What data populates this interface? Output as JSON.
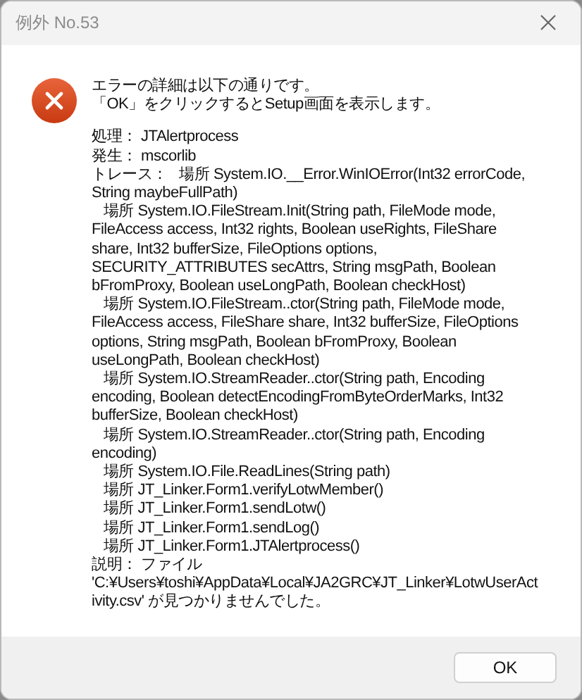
{
  "window": {
    "title": "例外 No.53"
  },
  "message": [
    "エラーの詳細は以下の通りです。",
    "「OK」をクリックするとSetup画面を表示します。"
  ],
  "details": [
    "処理： JTAlertprocess",
    "発生： mscorlib",
    "トレース：   場所 System.IO.__Error.WinIOError(Int32 errorCode,",
    "String maybeFullPath)",
    "   場所 System.IO.FileStream.Init(String path, FileMode mode,",
    "FileAccess access, Int32 rights, Boolean useRights, FileShare",
    "share, Int32 bufferSize, FileOptions options,",
    "SECURITY_ATTRIBUTES secAttrs, String msgPath, Boolean",
    "bFromProxy, Boolean useLongPath, Boolean checkHost)",
    "   場所 System.IO.FileStream..ctor(String path, FileMode mode,",
    "FileAccess access, FileShare share, Int32 bufferSize, FileOptions",
    "options, String msgPath, Boolean bFromProxy, Boolean",
    "useLongPath, Boolean checkHost)",
    "   場所 System.IO.StreamReader..ctor(String path, Encoding",
    "encoding, Boolean detectEncodingFromByteOrderMarks, Int32",
    "bufferSize, Boolean checkHost)",
    "   場所 System.IO.StreamReader..ctor(String path, Encoding",
    "encoding)",
    "   場所 System.IO.File.ReadLines(String path)",
    "   場所 JT_Linker.Form1.verifyLotwMember()",
    "   場所 JT_Linker.Form1.sendLotw()",
    "   場所 JT_Linker.Form1.sendLog()",
    "   場所 JT_Linker.Form1.JTAlertprocess()",
    "説明： ファイル",
    "'C:¥Users¥toshi¥AppData¥Local¥JA2GRC¥JT_Linker¥LotwUserAct",
    "ivity.csv' が見つかりませんでした。"
  ],
  "buttons": [
    "OK"
  ]
}
